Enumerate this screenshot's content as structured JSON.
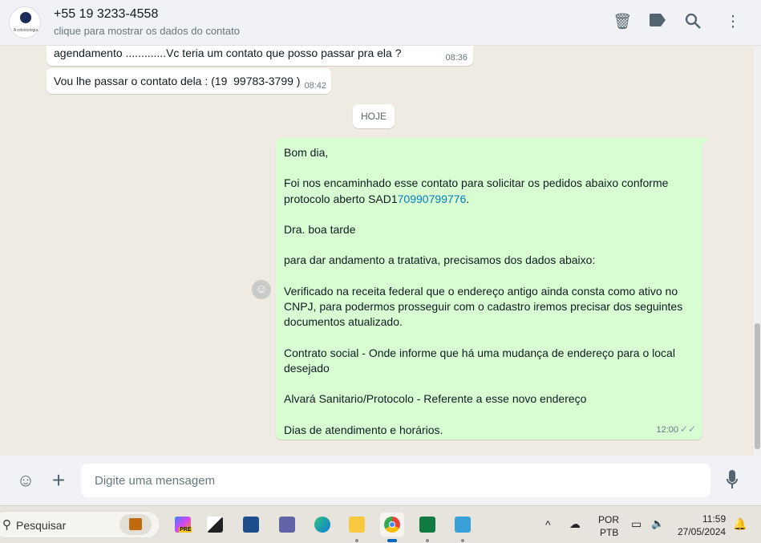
{
  "header": {
    "title": "+55 19 3233-4558",
    "subtitle": "clique para mostrar os dados do contato",
    "avatar_text": "A odontologia"
  },
  "messages": [
    {
      "text": "agendamento .............Vc teria um contato que posso passar pra ela ?",
      "time": "08:36"
    },
    {
      "text": "Vou lhe passar o contato dela : (19  99783-3799 )",
      "time": "08:42"
    }
  ],
  "date_divider": "HOJE",
  "outgoing": {
    "lines_before_link": "Bom dia,\n\nFoi nos encaminhado esse contato para solicitar os pedidos abaixo conforme protocolo aberto SAD1",
    "link": "70990799776",
    "lines_after_link": ".\n\nDra. boa tarde\n\npara dar andamento a tratativa, precisamos dos dados abaixo:\n\nVerificado na receita federal que o endereço antigo ainda consta como ativo no CNPJ, para podermos prosseguir com o cadastro iremos precisar dos seguintes documentos atualizado.\n\nContrato social - Onde informe que há uma mudança de endereço para o local desejado\n\nAlvará Sanitario/Protocolo - Referente a esse novo endereço\n\nDias de atendimento e horários.",
    "time": "12:00",
    "status": "✓✓"
  },
  "composer": {
    "placeholder": "Digite uma mensagem"
  },
  "taskbar": {
    "search": "Pesquisar",
    "lang1": "POR",
    "lang2": "PTB",
    "clock": "11:59",
    "date": "27/05/2024",
    "copilot_badge": "PRE"
  }
}
